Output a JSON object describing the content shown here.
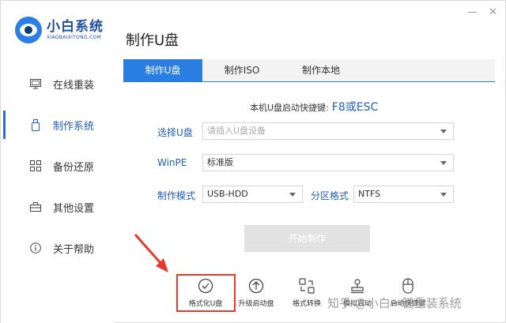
{
  "app": {
    "name": "小白系统",
    "subtitle": "XIAOBAIXITONG.COM"
  },
  "window": {
    "minimize_label": "—",
    "close_label": "✕"
  },
  "sidebar": {
    "items": [
      {
        "label": "在线重装",
        "icon": "monitor-icon",
        "active": false
      },
      {
        "label": "制作系统",
        "icon": "usb-drive-icon",
        "active": true
      },
      {
        "label": "备份还原",
        "icon": "grid-backup-icon",
        "active": false
      },
      {
        "label": "其他设置",
        "icon": "toolbox-icon",
        "active": false
      },
      {
        "label": "关于帮助",
        "icon": "info-icon",
        "active": false
      }
    ]
  },
  "page": {
    "title": "制作U盘"
  },
  "tabs": [
    {
      "label": "制作U盘",
      "active": true
    },
    {
      "label": "制作ISO",
      "active": false
    },
    {
      "label": "制作本地",
      "active": false
    }
  ],
  "hotkey": {
    "label": "本机U盘启动快捷键:",
    "key": "F8或ESC"
  },
  "form": {
    "usb_label": "选择U盘",
    "usb_placeholder": "请插入U盘设备",
    "winpe_label": "WinPE",
    "winpe_value": "标准版",
    "mode_label": "制作模式",
    "mode_value": "USB-HDD",
    "partition_label": "分区格式",
    "partition_value": "NTFS"
  },
  "start_button": "开始制作",
  "tools": [
    {
      "label": "格式化U盘",
      "icon": "check-circle-icon",
      "highlighted": true
    },
    {
      "label": "升级启动盘",
      "icon": "upload-circle-icon",
      "highlighted": false
    },
    {
      "label": "格式转换",
      "icon": "convert-icon",
      "highlighted": false
    },
    {
      "label": "模拟启动",
      "icon": "stamp-icon",
      "highlighted": false
    },
    {
      "label": "启动快捷键",
      "icon": "mouse-icon",
      "highlighted": false
    }
  ],
  "watermark": "知乎 @小白一键重装系统",
  "colors": {
    "accent": "#2a7de1",
    "nav_active": "#1f5fb8",
    "highlight": "#e53b2c"
  }
}
